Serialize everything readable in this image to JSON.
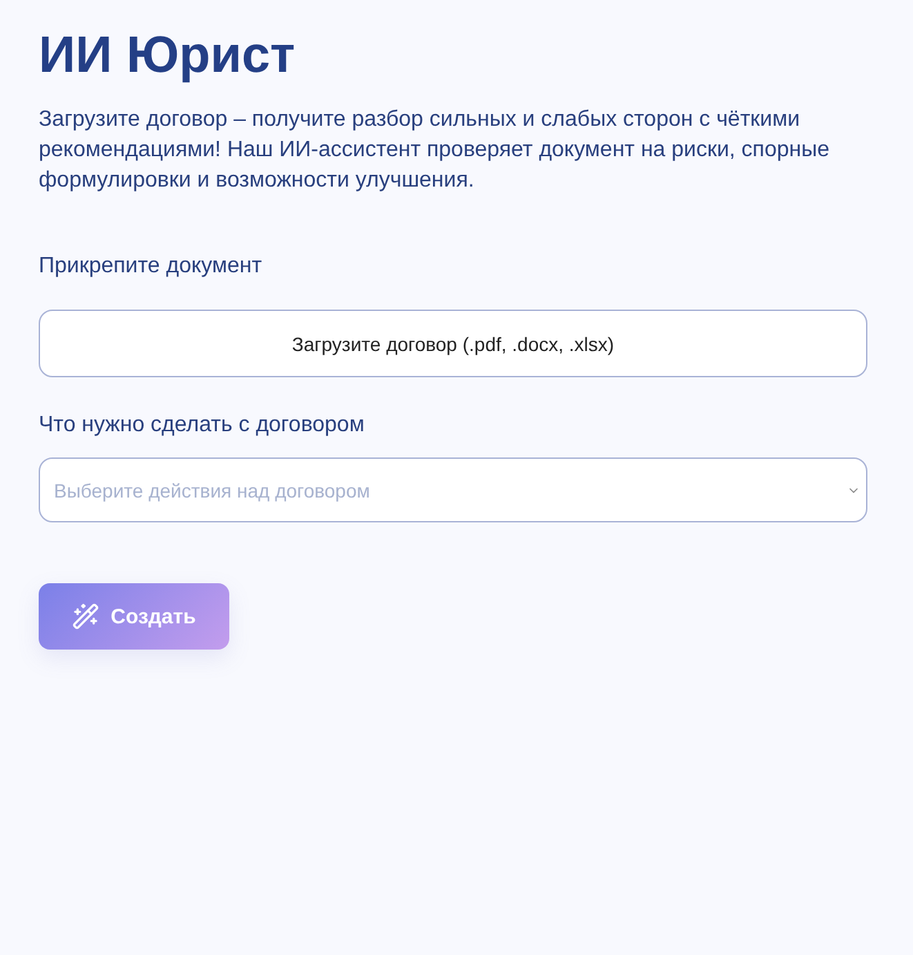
{
  "title": "ИИ Юрист",
  "description": "Загрузите договор – получите разбор сильных и слабых сторон с чёткими рекомендациями! Наш ИИ-ассистент проверяет документ на риски, спорные формулировки и возможности улучшения.",
  "upload": {
    "label": "Прикрепите документ",
    "button": "Загрузите договор (.pdf, .docx, .xlsx)"
  },
  "action": {
    "label": "Что нужно сделать с договором",
    "placeholder": "Выберите действия над договором"
  },
  "submit": "Создать"
}
